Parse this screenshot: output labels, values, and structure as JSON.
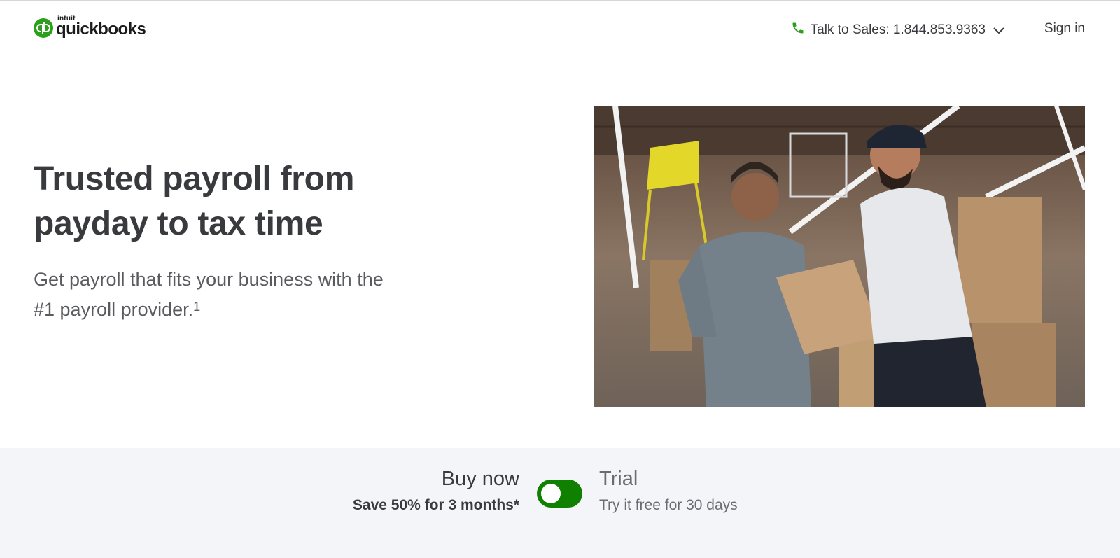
{
  "header": {
    "logo": {
      "brand": "intuit",
      "name": "quickbooks",
      "icon": "qb-logo-icon"
    },
    "sales_label": "Talk to Sales: 1.844.853.9363",
    "signin_label": "Sign in",
    "colors": {
      "brand_green": "#2ca01c"
    }
  },
  "hero": {
    "title": "Trusted payroll from payday to tax time",
    "subtitle": "Get payroll that fits your business with the #1 payroll provider.",
    "subtitle_sup": "1"
  },
  "toggle_band": {
    "buy_title": "Buy now",
    "buy_sub": "Save 50% for 3 months*",
    "trial_title": "Trial",
    "trial_sub": "Try it free for 30 days",
    "toggle_state": "buy-now",
    "toggle_color": "#108000"
  }
}
